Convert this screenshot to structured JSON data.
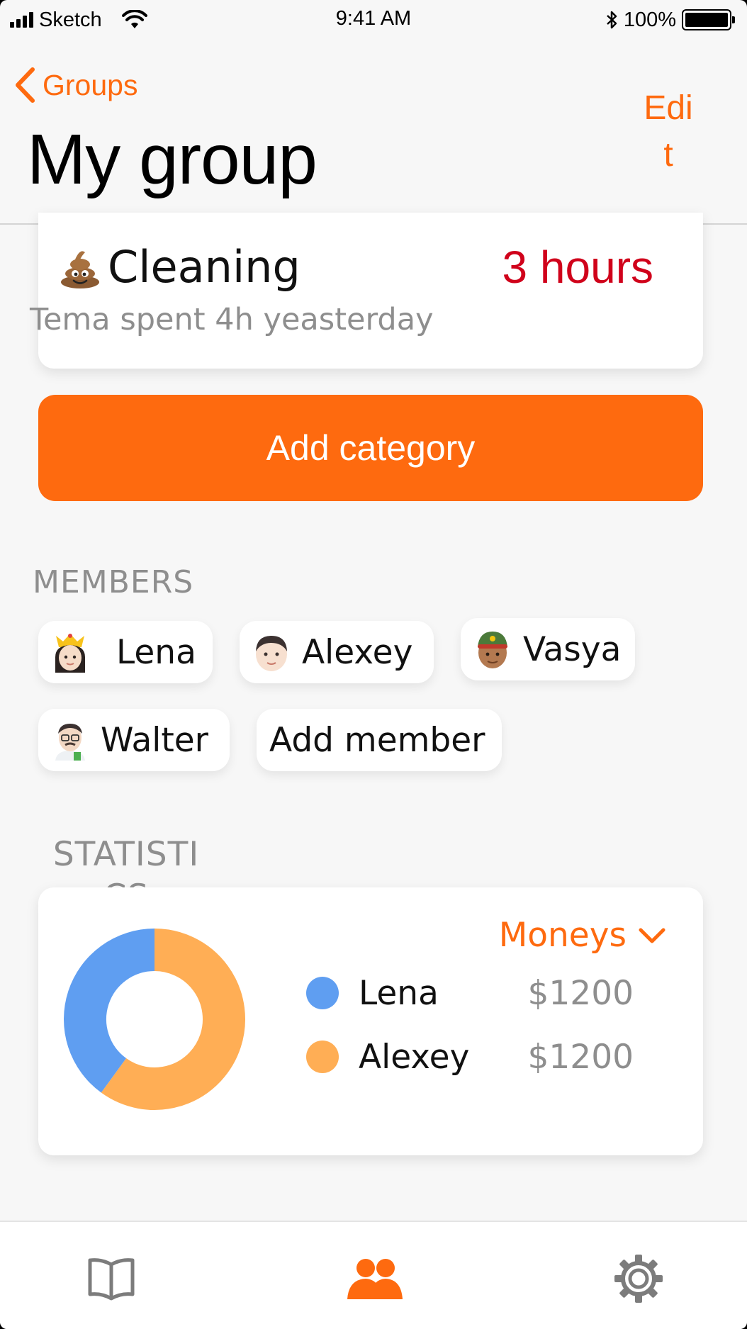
{
  "status_bar": {
    "carrier": "Sketch",
    "time": "9:41 AM",
    "battery": "100%"
  },
  "nav": {
    "back_label": "Groups",
    "edit_label": "Edit",
    "title": "My group"
  },
  "category": {
    "icon": "poo-emoji-icon",
    "name": "Cleaning",
    "hours": "3 hours",
    "subtitle": "Tema spent 4h yeasterday"
  },
  "add_category_label": "Add category",
  "members": {
    "label": "MEMBERS",
    "items": [
      {
        "name": "Lena",
        "avatar": "woman-crown-emoji-icon"
      },
      {
        "name": "Alexey",
        "avatar": "boy-emoji-icon"
      },
      {
        "name": "Vasya",
        "avatar": "man-cap-emoji-icon"
      },
      {
        "name": "Walter",
        "avatar": "scientist-emoji-icon"
      }
    ],
    "add_label": "Add member"
  },
  "statistics": {
    "label": "STATISTICS",
    "dropdown_label": "Moneys",
    "legend": [
      {
        "name": "Lena",
        "value": "$1200",
        "color": "#5f9ef1"
      },
      {
        "name": "Alexey",
        "value": "$1200",
        "color": "#ffae55"
      }
    ]
  },
  "chart_data": {
    "type": "pie",
    "series": [
      {
        "name": "Lena",
        "value": 40,
        "color": "#5f9ef1"
      },
      {
        "name": "Alexey",
        "value": 60,
        "color": "#ffae55"
      }
    ]
  },
  "tab_bar": {
    "items": [
      {
        "icon": "book-icon",
        "active": false
      },
      {
        "icon": "people-icon",
        "active": true
      },
      {
        "icon": "gear-icon",
        "active": false
      }
    ]
  },
  "colors": {
    "accent": "#fe6a0f",
    "hours": "#d0021b",
    "muted": "#8e8e8e"
  }
}
